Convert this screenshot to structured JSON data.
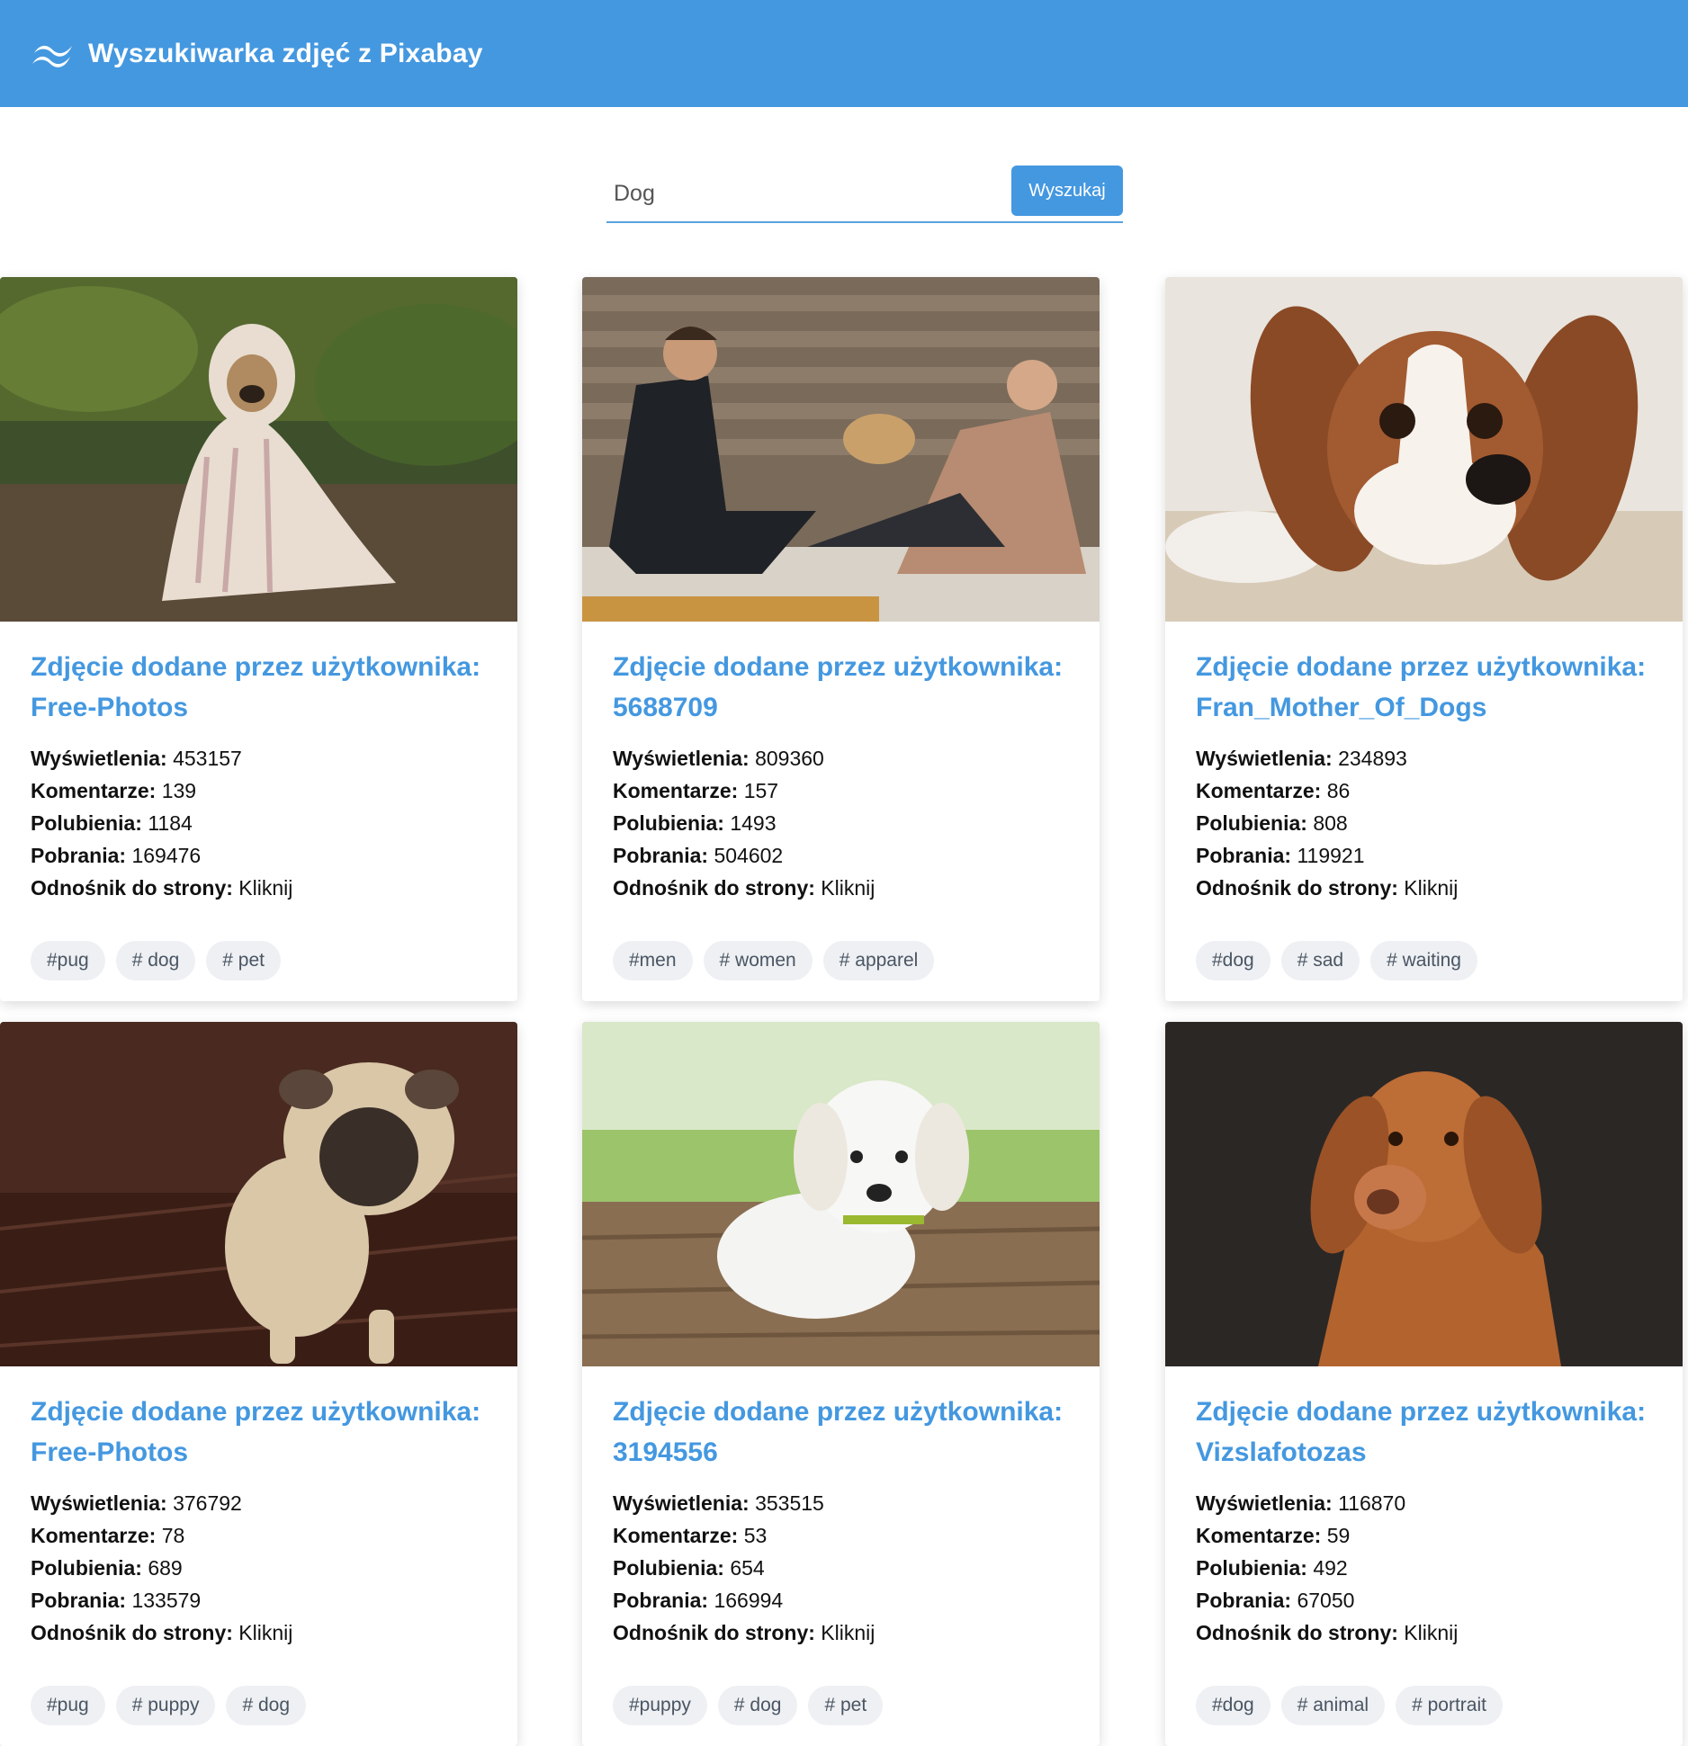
{
  "header": {
    "title": "Wyszukiwarka zdjęć z Pixabay",
    "logo_icon": "wave-logo-icon"
  },
  "search": {
    "value": "Dog",
    "button_label": "Wyszukaj"
  },
  "labels": {
    "title_prefix": "Zdjęcie dodane przez użytkownika:",
    "views": "Wyświetlenia:",
    "comments": "Komentarze:",
    "likes": "Polubienia:",
    "downloads": "Pobrania:",
    "link": "Odnośnik do strony:",
    "link_text": "Kliknij"
  },
  "cards": [
    {
      "user": "Free-Photos",
      "views": "453157",
      "comments": "139",
      "likes": "1184",
      "downloads": "169476",
      "tags": [
        "#pug",
        "# dog",
        "# pet"
      ]
    },
    {
      "user": "5688709",
      "views": "809360",
      "comments": "157",
      "likes": "1493",
      "downloads": "504602",
      "tags": [
        "#men",
        "# women",
        "# apparel"
      ]
    },
    {
      "user": "Fran_Mother_Of_Dogs",
      "views": "234893",
      "comments": "86",
      "likes": "808",
      "downloads": "119921",
      "tags": [
        "#dog",
        "# sad",
        "# waiting"
      ]
    },
    {
      "user": "Free-Photos",
      "views": "376792",
      "comments": "78",
      "likes": "689",
      "downloads": "133579",
      "tags": [
        "#pug",
        "# puppy",
        "# dog"
      ]
    },
    {
      "user": "3194556",
      "views": "353515",
      "comments": "53",
      "likes": "654",
      "downloads": "166994",
      "tags": [
        "#puppy",
        "# dog",
        "# pet"
      ]
    },
    {
      "user": "Vizslafotozas",
      "views": "116870",
      "comments": "59",
      "likes": "492",
      "downloads": "67050",
      "tags": [
        "#dog",
        "# animal",
        "# portrait"
      ]
    }
  ],
  "colors": {
    "accent": "#4498e0",
    "tag_bg": "#eef0f3"
  }
}
